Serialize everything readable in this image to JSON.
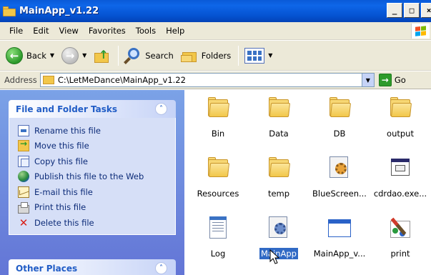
{
  "window": {
    "title": "MainApp_v1.22",
    "controls": [
      "_",
      "□",
      "×"
    ]
  },
  "menu": [
    "File",
    "Edit",
    "View",
    "Favorites",
    "Tools",
    "Help"
  ],
  "toolbar": {
    "back_label": "Back",
    "search_label": "Search",
    "folders_label": "Folders"
  },
  "address": {
    "label": "Address",
    "path": "C:\\LetMeDance\\MainApp_v1.22",
    "go_label": "Go"
  },
  "task_pane": {
    "file_folder_tasks": {
      "title": "File and Folder Tasks",
      "tasks": [
        {
          "label": "Rename this file",
          "icon": "rename-icon"
        },
        {
          "label": "Move this file",
          "icon": "move-icon"
        },
        {
          "label": "Copy this file",
          "icon": "copy-icon"
        },
        {
          "label": "Publish this file to the Web",
          "icon": "publish-web-icon"
        },
        {
          "label": "E-mail this file",
          "icon": "email-icon"
        },
        {
          "label": "Print this file",
          "icon": "print-icon"
        },
        {
          "label": "Delete this file",
          "icon": "delete-icon"
        }
      ]
    },
    "other_places": {
      "title": "Other Places"
    }
  },
  "files": [
    {
      "name": "Bin",
      "icon": "folder-icon"
    },
    {
      "name": "Data",
      "icon": "folder-icon"
    },
    {
      "name": "DB",
      "icon": "folder-icon"
    },
    {
      "name": "output",
      "icon": "folder-icon"
    },
    {
      "name": "Resources",
      "icon": "folder-icon"
    },
    {
      "name": "temp",
      "icon": "folder-icon"
    },
    {
      "name": "BlueScreen...",
      "icon": "settings-file-icon"
    },
    {
      "name": "cdrdao.exe...",
      "icon": "executable-icon"
    },
    {
      "name": "Log",
      "icon": "text-document-icon"
    },
    {
      "name": "MainApp",
      "icon": "application-icon",
      "selected": true
    },
    {
      "name": "MainApp_v...",
      "icon": "window-icon"
    },
    {
      "name": "print",
      "icon": "paint-icon"
    }
  ],
  "colors": {
    "title_bar": "#0a5ad8",
    "task_pane": "#7ba2e7",
    "selection": "#316ac5"
  }
}
